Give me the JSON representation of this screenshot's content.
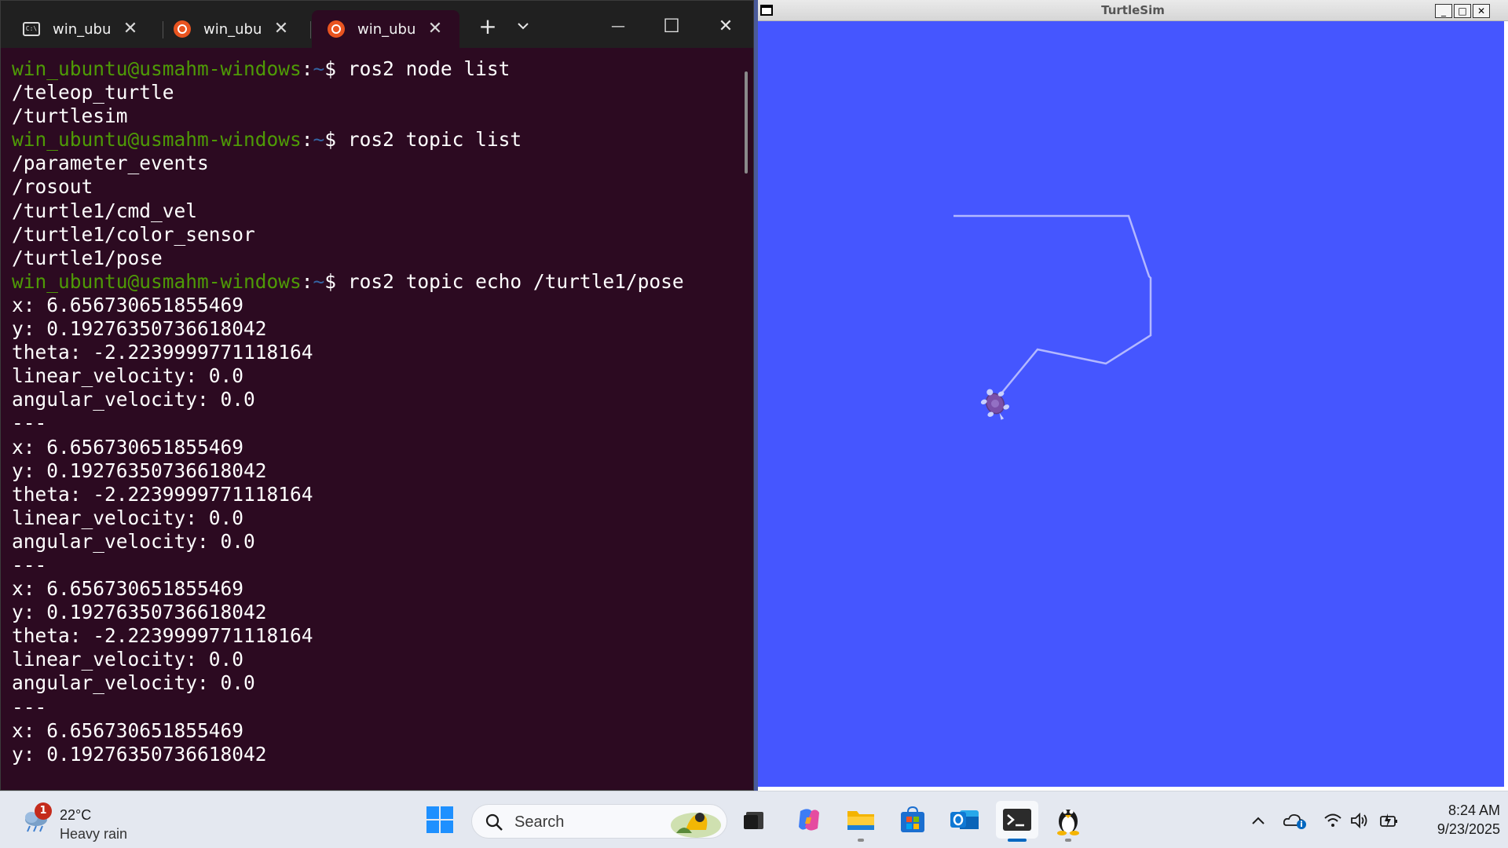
{
  "terminal": {
    "tabs": [
      {
        "label": "win_ubuntu",
        "icon": "cmd-icon",
        "active": false
      },
      {
        "label": "win_ubuntu",
        "icon": "ubuntu-icon",
        "active": false
      },
      {
        "label": "win_ubuntu",
        "icon": "ubuntu-icon",
        "active": true
      }
    ],
    "new_tab_glyph": "+",
    "dropdown_glyph": "⌄",
    "minimize_glyph": "—",
    "maximize_glyph": "☐",
    "close_glyph": "✕",
    "tab_close_glyph": "✕",
    "prompt": {
      "user": "win_ubuntu@usmahm-windows",
      "colon": ":",
      "path": "~",
      "dollar": "$ "
    },
    "lines": [
      {
        "type": "prompt",
        "cmd": "ros2 node list"
      },
      {
        "type": "out",
        "text": "/teleop_turtle"
      },
      {
        "type": "out",
        "text": "/turtlesim"
      },
      {
        "type": "prompt",
        "cmd": "ros2 topic list"
      },
      {
        "type": "out",
        "text": "/parameter_events"
      },
      {
        "type": "out",
        "text": "/rosout"
      },
      {
        "type": "out",
        "text": "/turtle1/cmd_vel"
      },
      {
        "type": "out",
        "text": "/turtle1/color_sensor"
      },
      {
        "type": "out",
        "text": "/turtle1/pose"
      },
      {
        "type": "prompt",
        "cmd": "ros2 topic echo /turtle1/pose"
      },
      {
        "type": "out",
        "text": "x: 6.656730651855469"
      },
      {
        "type": "out",
        "text": "y: 0.19276350736618042"
      },
      {
        "type": "out",
        "text": "theta: -2.2239999771118164"
      },
      {
        "type": "out",
        "text": "linear_velocity: 0.0"
      },
      {
        "type": "out",
        "text": "angular_velocity: 0.0"
      },
      {
        "type": "out",
        "text": "---"
      },
      {
        "type": "out",
        "text": "x: 6.656730651855469"
      },
      {
        "type": "out",
        "text": "y: 0.19276350736618042"
      },
      {
        "type": "out",
        "text": "theta: -2.2239999771118164"
      },
      {
        "type": "out",
        "text": "linear_velocity: 0.0"
      },
      {
        "type": "out",
        "text": "angular_velocity: 0.0"
      },
      {
        "type": "out",
        "text": "---"
      },
      {
        "type": "out",
        "text": "x: 6.656730651855469"
      },
      {
        "type": "out",
        "text": "y: 0.19276350736618042"
      },
      {
        "type": "out",
        "text": "theta: -2.2239999771118164"
      },
      {
        "type": "out",
        "text": "linear_velocity: 0.0"
      },
      {
        "type": "out",
        "text": "angular_velocity: 0.0"
      },
      {
        "type": "out",
        "text": "---"
      },
      {
        "type": "out",
        "text": "x: 6.656730651855469"
      },
      {
        "type": "out",
        "text": "y: 0.19276350736618042"
      }
    ],
    "colors": {
      "background": "#2c0a21",
      "user": "#4e9a06",
      "path": "#3465a4",
      "text": "#ffffff"
    }
  },
  "turtlesim": {
    "title": "TurtleSim",
    "minimize_glyph": "_",
    "maximize_glyph": "□",
    "close_glyph": "✕",
    "background_color": "#4556ff",
    "pen_color": "#b3b8ff",
    "turtle_color": "#7a4fa8"
  },
  "taskbar": {
    "weather": {
      "temp": "22°C",
      "desc": "Heavy rain",
      "badge": "1"
    },
    "search": {
      "label": "Search"
    },
    "apps": [
      "start-icon",
      "task-view-icon",
      "copilot-icon",
      "file-explorer-icon",
      "store-icon",
      "outlook-icon",
      "terminal-icon",
      "linux-tux-icon"
    ],
    "tray": [
      "chevron-up-icon",
      "onedrive-icon",
      "wifi-icon",
      "volume-icon",
      "battery-icon"
    ],
    "clock": {
      "time": "8:24 AM",
      "date": "9/23/2025"
    },
    "accent": "#0067c0"
  }
}
